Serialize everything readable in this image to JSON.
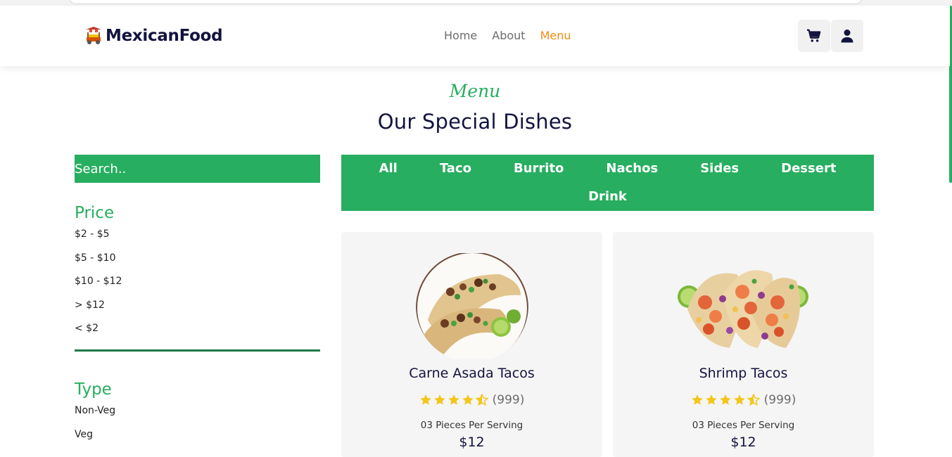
{
  "brand": {
    "name": "MexicanFood",
    "icon": "food-cart-icon"
  },
  "nav": {
    "links": [
      {
        "label": "Home",
        "active": false
      },
      {
        "label": "About",
        "active": false
      },
      {
        "label": "Menu",
        "active": true
      }
    ],
    "cart_icon": "cart-icon",
    "user_icon": "user-icon"
  },
  "section": {
    "subtitle": "Menu",
    "title": "Our Special Dishes"
  },
  "search": {
    "placeholder": "Search.."
  },
  "filters": {
    "price": {
      "title": "Price",
      "options": [
        "$2 - $5",
        "$5 - $10",
        "$10 - $12",
        "> $12",
        "< $2"
      ]
    },
    "type": {
      "title": "Type",
      "options": [
        "Non-Veg",
        "Veg"
      ]
    }
  },
  "categories": {
    "row1": [
      "All",
      "Taco",
      "Burrito",
      "Nachos",
      "Sides",
      "Dessert"
    ],
    "row2": [
      "Drink"
    ]
  },
  "products": [
    {
      "name": "Carne Asada Tacos",
      "rating_count": "(999)",
      "stars": 4.5,
      "serving": "03 Pieces Per Serving",
      "price": "$12"
    },
    {
      "name": "Shrimp Tacos",
      "rating_count": "(999)",
      "stars": 4.5,
      "serving": "03 Pieces Per Serving",
      "price": "$12"
    }
  ],
  "colors": {
    "accent": "#27ae60",
    "active_nav": "#f08c14",
    "text_dark": "#13133f",
    "star": "#f5c518"
  }
}
